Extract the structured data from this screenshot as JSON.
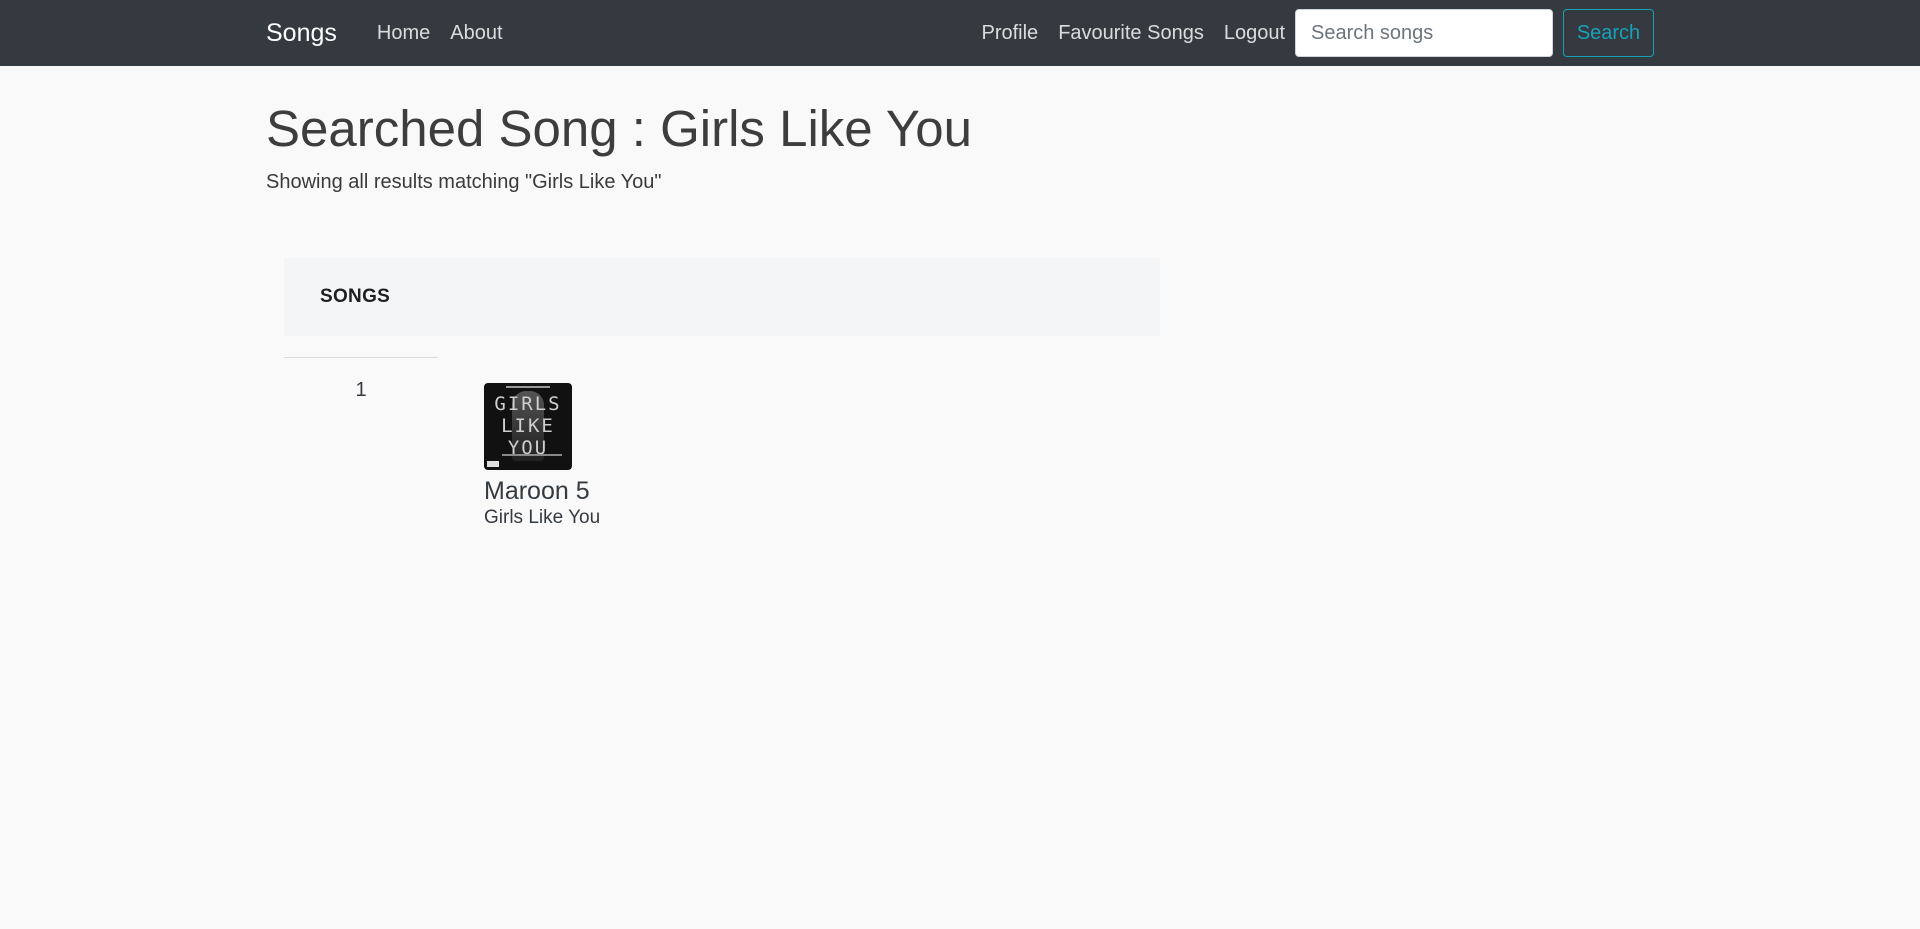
{
  "navbar": {
    "brand": "Songs",
    "left_links": [
      "Home",
      "About"
    ],
    "right_links": [
      "Profile",
      "Favourite Songs",
      "Logout"
    ],
    "search_placeholder": "Search songs",
    "search_button": "Search"
  },
  "page": {
    "title": "Searched Song : Girls Like You",
    "subtitle": "Showing all results matching \"Girls Like You\""
  },
  "table": {
    "header": "SONGS",
    "rows": [
      {
        "rank": "1",
        "artist": "Maroon 5",
        "song": "Girls Like You",
        "cover_text": [
          "GIRLS",
          "LIKE",
          "YOU"
        ]
      }
    ]
  },
  "colors": {
    "navbar_bg": "#343a40",
    "accent": "#17a2b8",
    "page_bg": "#f9f9f9"
  }
}
